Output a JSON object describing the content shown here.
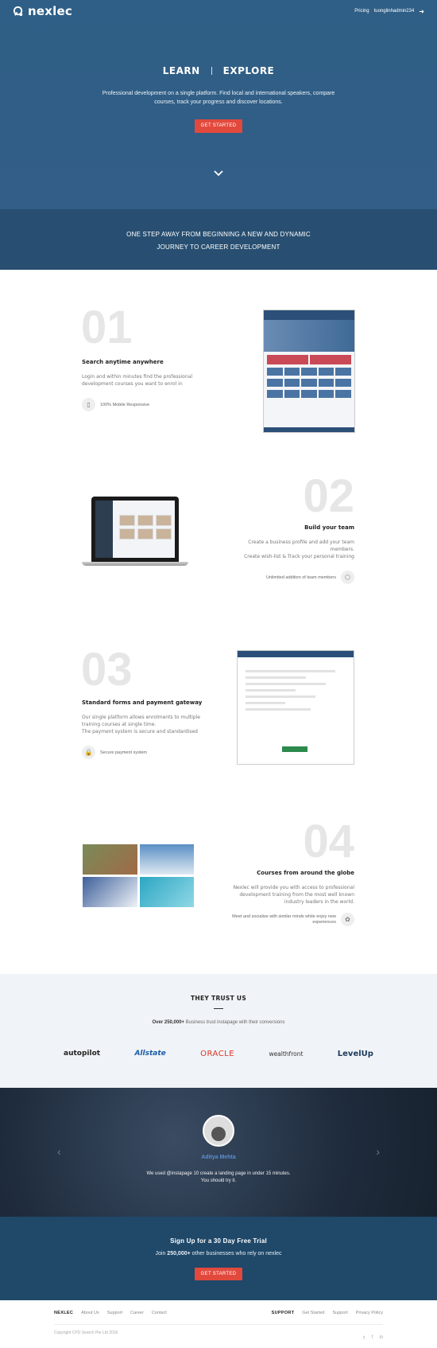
{
  "brand": {
    "name": "nexlec"
  },
  "topnav": {
    "pricing": "Pricing",
    "user": "tuonglinhadmin234"
  },
  "hero": {
    "title_left": "LEARN",
    "title_right": "EXPLORE",
    "subtitle": "Professional development on a single platform. Find local and international speakers, compare courses, track your progress and discover locations.",
    "cta": "GET STARTED"
  },
  "band": {
    "line1": "ONE STEP AWAY FROM BEGINNING A NEW AND DYNAMIC",
    "line2": "JOURNEY TO CAREER DEVELOPMENT"
  },
  "features": [
    {
      "number": "01",
      "title": "Search anytime anywhere",
      "desc": "Login and within minutes find the professional development courses you want to enrol in",
      "note": "100% Mobile Responsive",
      "icon": "mobile-icon"
    },
    {
      "number": "02",
      "title": "Build your team",
      "desc1": "Create a business profile and add your team members.",
      "desc2": "Create wish-list & Track your personal training",
      "note": "Unlimited addition of team members",
      "icon": "team-icon"
    },
    {
      "number": "03",
      "title": "Standard forms and payment gateway",
      "desc1": "Our single platform allows enrolments to multiple training courses at single time.",
      "desc2": "The payment system is secure and standardised",
      "note": "Secure payment system",
      "icon": "lock-icon"
    },
    {
      "number": "04",
      "title": "Courses from around the globe",
      "desc": "Nexlec will provide you with access to professional development training from the most well known industry leaders in the world.",
      "note": "Meet and socialise with similar minds while enjoy new experiences",
      "icon": "globe-icon"
    }
  ],
  "trust": {
    "title": "THEY TRUST US",
    "count": "Over 250,000+",
    "text": "Business trust instapage with their conversions",
    "logos": [
      "autopilot",
      "Allstate",
      "ORACLE",
      "wealthfront",
      "LevelUp"
    ]
  },
  "testimonial": {
    "name": "Aditya Mehta",
    "quote": "We used @instapage 10 create a landing page in under 15 minutes. You should try it."
  },
  "signup": {
    "title": "Sign Up for a 30 Day Free Trial",
    "pre": "Join",
    "count": "250,000+",
    "post": "other businesses who rely on nexlec",
    "cta": "GET STARTED"
  },
  "footer": {
    "left_head": "NEXLEC",
    "left_links": [
      "About Us",
      "Support",
      "Career",
      "Contact"
    ],
    "right_head": "SUPPORT",
    "right_links": [
      "Get Started",
      "Support",
      "Privacy Policy"
    ],
    "copyright": "Copyright CPD Search Pte Ltd 2016"
  },
  "colors": {
    "hero": "#2f5f86",
    "band": "#284f71",
    "cta": "#e2493d",
    "signup": "#1f4869"
  }
}
